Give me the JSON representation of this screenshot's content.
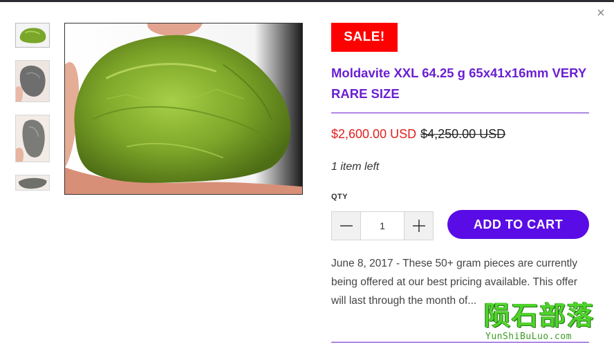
{
  "modal": {
    "close_glyph": "×",
    "close_icon": "close-icon"
  },
  "gallery": {
    "thumbnails": [
      {
        "name": "thumbnail-1",
        "color": "#7aa62a"
      },
      {
        "name": "thumbnail-2",
        "color": "#6e6e6e"
      },
      {
        "name": "thumbnail-3",
        "color": "#7b7b78"
      },
      {
        "name": "thumbnail-4",
        "color": "#6f706c"
      }
    ],
    "main_image_color": "#7ea629"
  },
  "product": {
    "badge": "SALE!",
    "title": "Moldavite XXL 64.25 g 65x41x16mm VERY RARE SIZE",
    "price": "$2,600.00 USD",
    "compare_price": "$4,250.00 USD",
    "stock": "1 item left",
    "qty_label": "QTY",
    "qty_value": "1",
    "add_to_cart": "ADD TO CART",
    "description": "June 8, 2017 - These 50+ gram pieces are currently being offered at our best pricing available. This offer will last through the month of..."
  },
  "watermark": {
    "chinese": "陨石部落",
    "latin": "YunShiBuLuo.com"
  },
  "colors": {
    "accent": "#6a1fd2",
    "button": "#5a0ce6",
    "sale_badge": "#ff0000",
    "price": "#e0201f"
  }
}
